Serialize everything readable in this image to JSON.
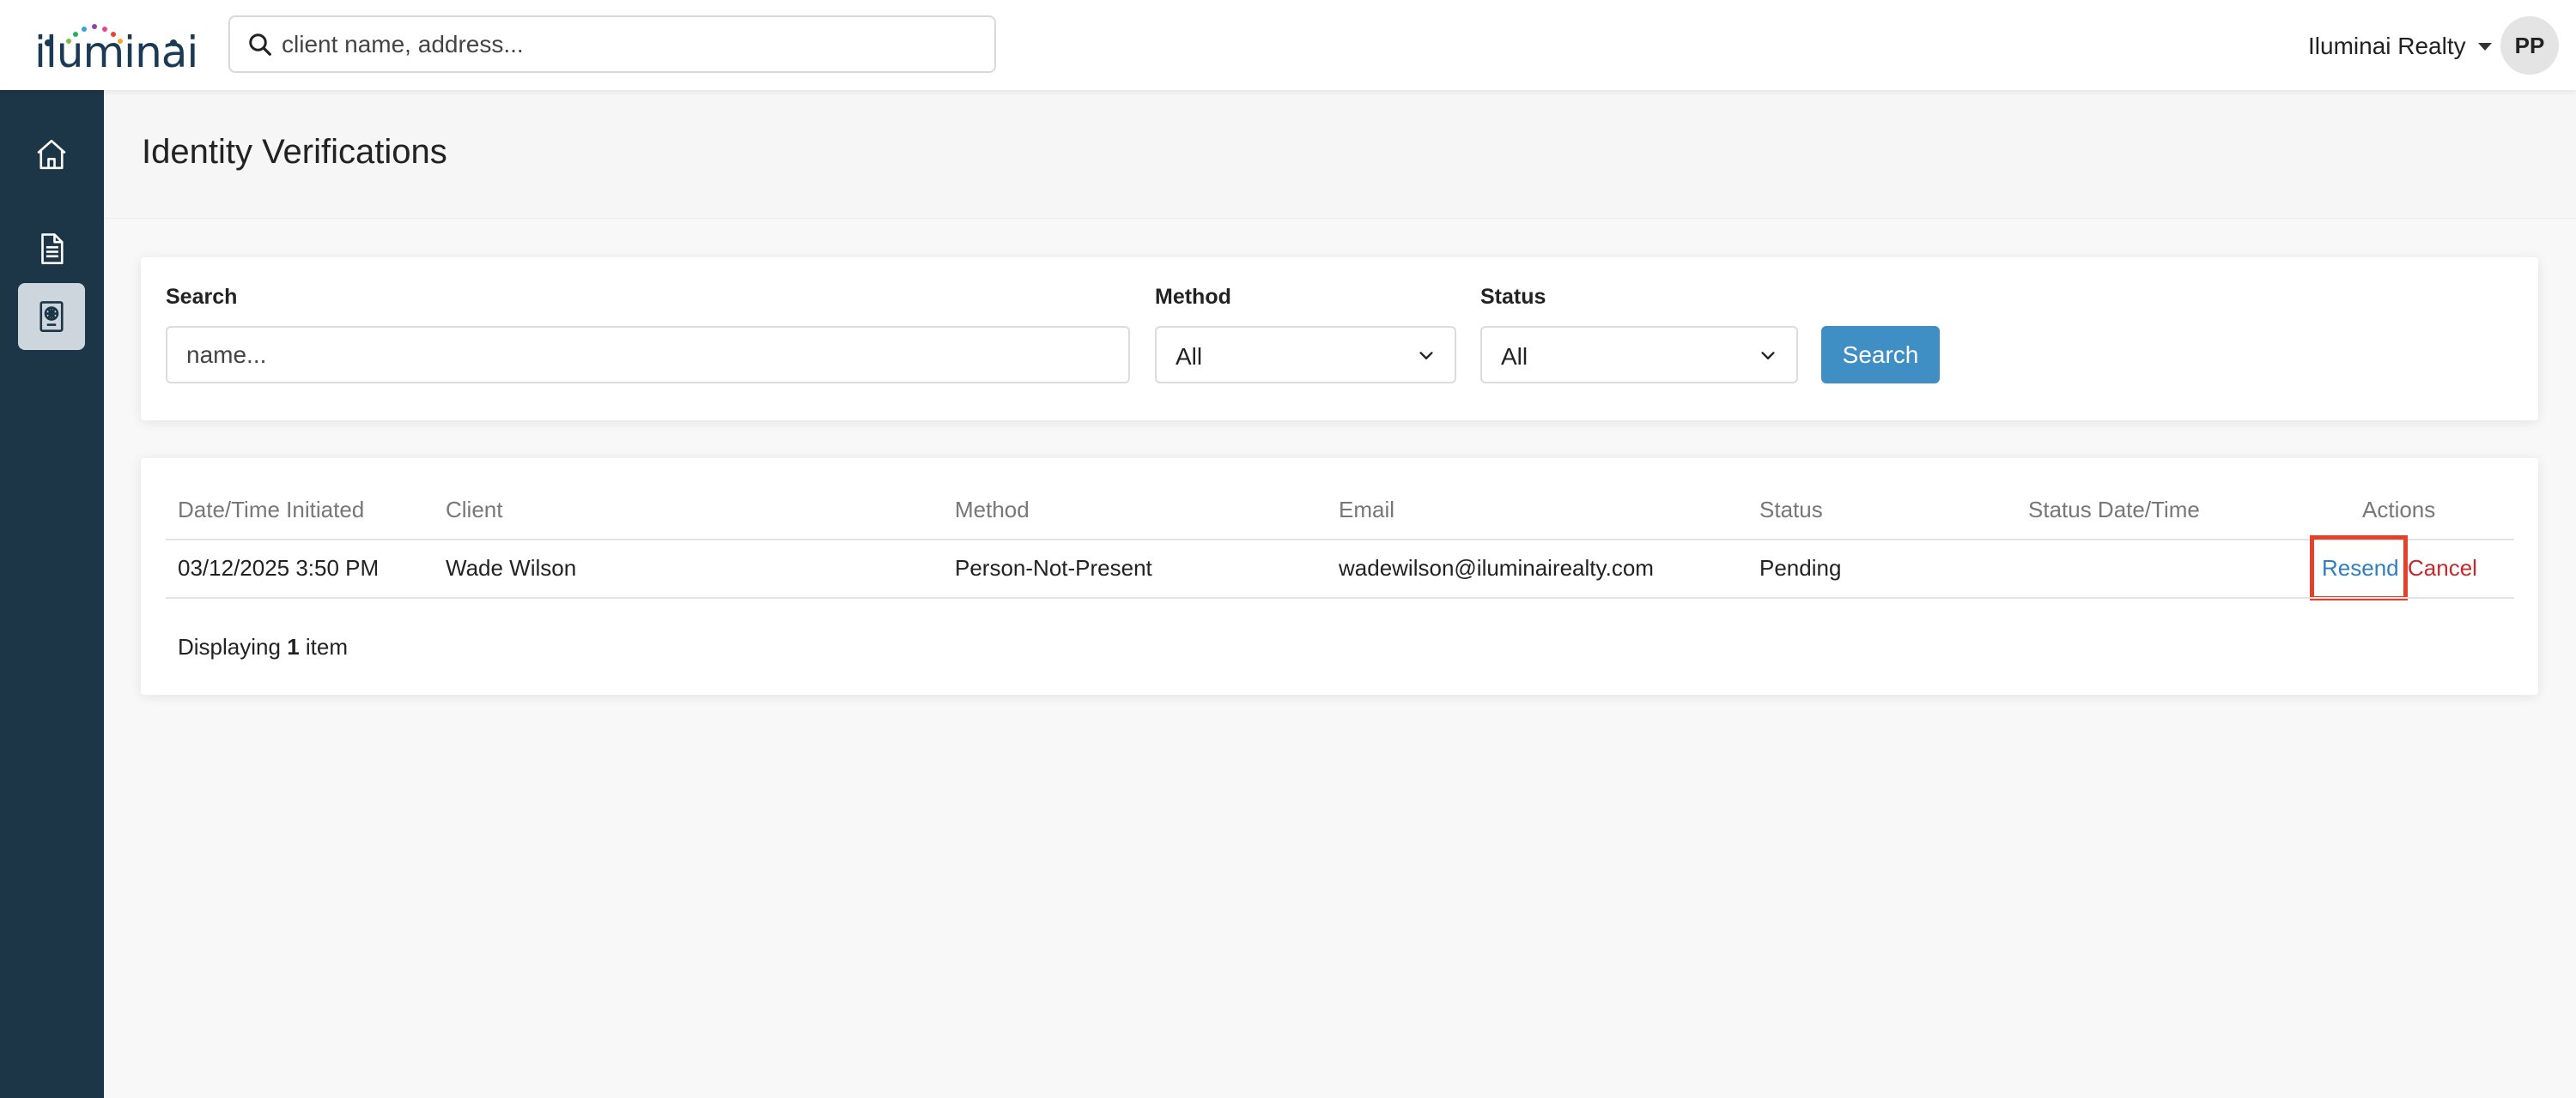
{
  "brand": {
    "logo_text": "iluminai",
    "logo_dot_colors": [
      "#e8452c",
      "#f5a623",
      "#7ac043",
      "#2fa6d8",
      "#8e44ad",
      "#e84393",
      "#27ae60"
    ]
  },
  "header": {
    "search_placeholder": "client name, address...",
    "org_name": "Iluminai Realty",
    "avatar_initials": "PP"
  },
  "sidebar": {
    "items": [
      {
        "icon": "home-icon",
        "active": false
      },
      {
        "icon": "document-icon",
        "active": false
      },
      {
        "icon": "id-verification-icon",
        "active": true
      }
    ]
  },
  "page": {
    "title": "Identity Verifications"
  },
  "filters": {
    "search_label": "Search",
    "search_placeholder": "name...",
    "method_label": "Method",
    "method_value": "All",
    "status_label": "Status",
    "status_value": "All",
    "search_button": "Search"
  },
  "table": {
    "columns": [
      "Date/Time Initiated",
      "Client",
      "Method",
      "Email",
      "Status",
      "Status Date/Time",
      "Actions"
    ],
    "rows": [
      {
        "datetime": "03/12/2025 3:50 PM",
        "client": "Wade Wilson",
        "method": "Person-Not-Present",
        "email": "wadewilson@iluminairealty.com",
        "status": "Pending",
        "status_datetime": "",
        "actions": [
          "Resend",
          "Cancel"
        ]
      }
    ],
    "footer": {
      "prefix": "Displaying",
      "count": "1",
      "suffix": "item"
    }
  },
  "colors": {
    "sidebar_bg": "#1c3547",
    "primary_button": "#3f8fc4",
    "link_blue": "#2f7fbf",
    "cancel_red": "#c8272c",
    "highlight": "#e5412a"
  }
}
